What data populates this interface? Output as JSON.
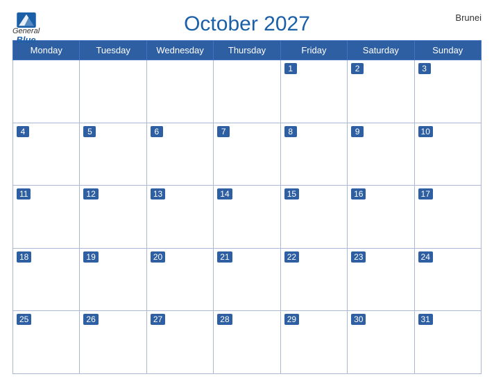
{
  "header": {
    "title": "October 2027",
    "country": "Brunei",
    "logo_general": "General",
    "logo_blue": "Blue"
  },
  "weekdays": [
    "Monday",
    "Tuesday",
    "Wednesday",
    "Thursday",
    "Friday",
    "Saturday",
    "Sunday"
  ],
  "weeks": [
    [
      null,
      null,
      null,
      null,
      1,
      2,
      3
    ],
    [
      4,
      5,
      6,
      7,
      8,
      9,
      10
    ],
    [
      11,
      12,
      13,
      14,
      15,
      16,
      17
    ],
    [
      18,
      19,
      20,
      21,
      22,
      23,
      24
    ],
    [
      25,
      26,
      27,
      28,
      29,
      30,
      31
    ]
  ]
}
